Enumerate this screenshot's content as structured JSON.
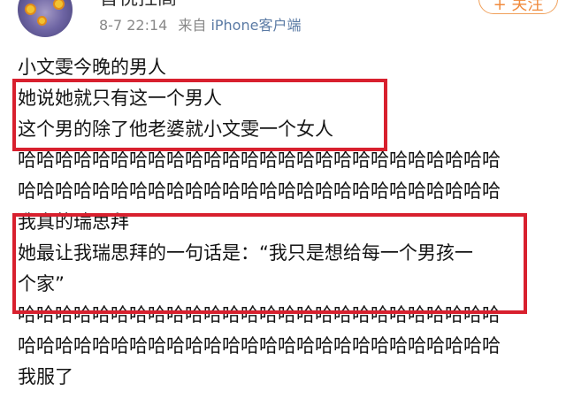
{
  "author": {
    "username": "音悦拄髙",
    "timestamp": "8-7 22:14",
    "source_prefix": "来自",
    "source": "iPhone客户端"
  },
  "follow_label": "+ 关注",
  "post_lines": [
    "小文雯今晚的男人",
    "她说她就只有这一个男人",
    "这个男的除了他老婆就小文雯一个女人",
    "哈哈哈哈哈哈哈哈哈哈哈哈哈哈哈哈哈哈哈哈哈哈哈哈哈哈",
    "哈哈哈哈哈哈哈哈哈哈哈哈哈哈哈哈哈哈哈哈哈哈哈哈哈哈",
    "我真的瑞思拜",
    "她最让我瑞思拜的一句话是：“我只是想给每一个男孩一",
    "个家”",
    "哈哈哈哈哈哈哈哈哈哈哈哈哈哈哈哈哈哈哈哈哈哈哈哈哈哈",
    "哈哈哈哈哈哈哈哈哈哈哈哈哈哈哈哈哈哈哈哈哈哈哈哈哈哈",
    "我服了"
  ],
  "colors": {
    "highlight_border": "#d8202e",
    "follow_accent": "#f08a3c",
    "source_link": "#5b7ba5",
    "meta_text": "#888888"
  }
}
